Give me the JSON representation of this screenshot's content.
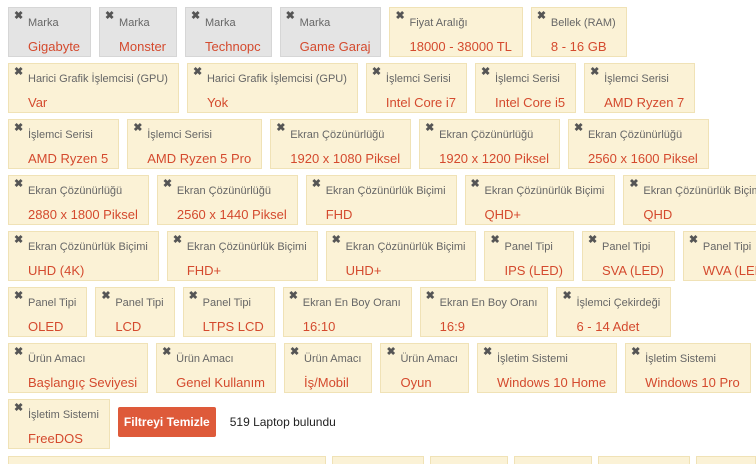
{
  "rows": [
    [
      {
        "cat": "Marka",
        "val": "Gigabyte",
        "brand": true
      },
      {
        "cat": "Marka",
        "val": "Monster",
        "brand": true
      },
      {
        "cat": "Marka",
        "val": "Technopc",
        "brand": true
      },
      {
        "cat": "Marka",
        "val": "Game Garaj",
        "brand": true
      },
      {
        "cat": "Fiyat Aralığı",
        "val": "18000 - 38000 TL"
      },
      {
        "cat": "Bellek (RAM)",
        "val": "8 - 16 GB"
      }
    ],
    [
      {
        "cat": "Harici Grafik İşlemcisi (GPU)",
        "val": "Var"
      },
      {
        "cat": "Harici Grafik İşlemcisi (GPU)",
        "val": "Yok"
      },
      {
        "cat": "İşlemci Serisi",
        "val": "Intel Core i7"
      },
      {
        "cat": "İşlemci Serisi",
        "val": "Intel Core i5"
      },
      {
        "cat": "İşlemci Serisi",
        "val": "AMD Ryzen 7"
      }
    ],
    [
      {
        "cat": "İşlemci Serisi",
        "val": "AMD Ryzen 5"
      },
      {
        "cat": "İşlemci Serisi",
        "val": "AMD Ryzen 5 Pro"
      },
      {
        "cat": "Ekran Çözünürlüğü",
        "val": "1920 x 1080 Piksel"
      },
      {
        "cat": "Ekran Çözünürlüğü",
        "val": "1920 x 1200 Piksel"
      },
      {
        "cat": "Ekran Çözünürlüğü",
        "val": "2560 x 1600 Piksel"
      }
    ],
    [
      {
        "cat": "Ekran Çözünürlüğü",
        "val": "2880 x 1800 Piksel"
      },
      {
        "cat": "Ekran Çözünürlüğü",
        "val": "2560 x 1440 Piksel"
      },
      {
        "cat": "Ekran Çözünürlük Biçimi",
        "val": "FHD"
      },
      {
        "cat": "Ekran Çözünürlük Biçimi",
        "val": "QHD+"
      },
      {
        "cat": "Ekran Çözünürlük Biçimi",
        "val": "QHD"
      }
    ],
    [
      {
        "cat": "Ekran Çözünürlük Biçimi",
        "val": "UHD (4K)"
      },
      {
        "cat": "Ekran Çözünürlük Biçimi",
        "val": "FHD+"
      },
      {
        "cat": "Ekran Çözünürlük Biçimi",
        "val": "UHD+"
      },
      {
        "cat": "Panel Tipi",
        "val": "IPS (LED)"
      },
      {
        "cat": "Panel Tipi",
        "val": "SVA (LED)"
      },
      {
        "cat": "Panel Tipi",
        "val": "WVA (LED)"
      }
    ],
    [
      {
        "cat": "Panel Tipi",
        "val": "OLED"
      },
      {
        "cat": "Panel Tipi",
        "val": "LCD"
      },
      {
        "cat": "Panel Tipi",
        "val": "LTPS LCD"
      },
      {
        "cat": "Ekran En Boy Oranı",
        "val": "16:10"
      },
      {
        "cat": "Ekran En Boy Oranı",
        "val": "16:9"
      },
      {
        "cat": "İşlemci Çekirdeği",
        "val": "6 - 14 Adet"
      }
    ],
    [
      {
        "cat": "Ürün Amacı",
        "val": "Başlangıç Seviyesi"
      },
      {
        "cat": "Ürün Amacı",
        "val": "Genel Kullanım"
      },
      {
        "cat": "Ürün Amacı",
        "val": "İş/Mobil"
      },
      {
        "cat": "Ürün Amacı",
        "val": "Oyun"
      },
      {
        "cat": "İşletim Sistemi",
        "val": "Windows 10 Home"
      },
      {
        "cat": "İşletim Sistemi",
        "val": "Windows 10 Pro"
      }
    ],
    [
      {
        "cat": "İşletim Sistemi",
        "val": "FreeDOS"
      }
    ]
  ],
  "remove_icon": "close-icon",
  "remove_glyph": "✖",
  "clear_button": "Filtreyi Temizle",
  "result_text": "519 Laptop bulundu",
  "colors": {
    "chip_bg": "#fbf2d6",
    "brand_chip_bg": "#e4e4e4",
    "value_text": "#d44a2e",
    "clear_button_bg": "#de5a3a"
  }
}
